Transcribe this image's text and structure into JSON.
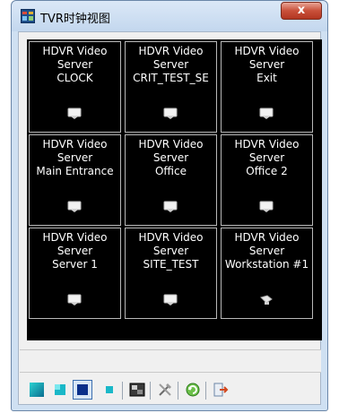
{
  "window": {
    "title": "TVR时钟视图",
    "close_label": "x"
  },
  "tiles": [
    {
      "line1": "HDVR Video",
      "line2": "Server",
      "line3": "CLOCK",
      "icon": "camera-icon"
    },
    {
      "line1": "HDVR Video",
      "line2": "Server",
      "line3": "CRIT_TEST_SE",
      "icon": "camera-icon"
    },
    {
      "line1": "HDVR Video",
      "line2": "Server",
      "line3": "Exit",
      "icon": "camera-icon"
    },
    {
      "line1": "HDVR Video",
      "line2": "Server",
      "line3": "Main Entrance",
      "icon": "camera-icon"
    },
    {
      "line1": "HDVR Video",
      "line2": "Server",
      "line3": "Office",
      "icon": "camera-icon"
    },
    {
      "line1": "HDVR Video",
      "line2": "Server",
      "line3": "Office 2",
      "icon": "camera-icon"
    },
    {
      "line1": "HDVR Video",
      "line2": "Server",
      "line3": "Server 1",
      "icon": "camera-icon"
    },
    {
      "line1": "HDVR Video",
      "line2": "Server",
      "line3": "SITE_TEST",
      "icon": "camera-icon"
    },
    {
      "line1": "HDVR Video",
      "line2": "Server",
      "line3": "Workstation #1",
      "icon": "camera-alt-icon"
    }
  ],
  "status_bar": {
    "text": ""
  },
  "toolbar": {
    "items": [
      {
        "icon": "view-large-icon",
        "selected": false
      },
      {
        "icon": "view-medium-icon",
        "selected": false
      },
      {
        "icon": "view-small-icon",
        "selected": true
      },
      {
        "icon": "view-tiny-icon",
        "selected": false
      },
      {
        "icon": "display-mode-icon",
        "selected": false
      },
      {
        "icon": "tools-icon",
        "selected": false
      },
      {
        "icon": "refresh-icon",
        "selected": false
      },
      {
        "icon": "export-icon",
        "selected": false
      }
    ]
  },
  "colors": {
    "grid_background": "#000000",
    "tile_border": "#b8b8b8",
    "tile_text": "#ffffff",
    "window_frame": "#cfe0f2",
    "close_button": "#c9503a"
  }
}
